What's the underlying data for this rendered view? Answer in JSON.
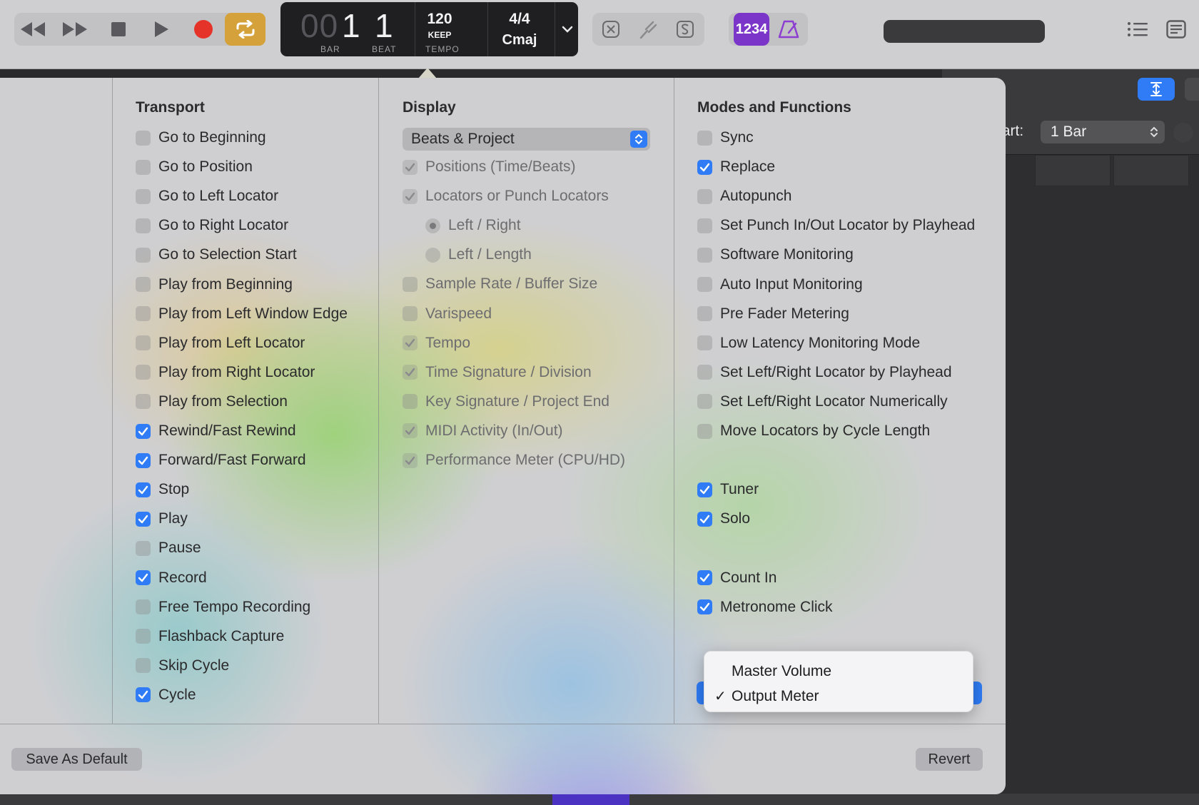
{
  "lcd": {
    "bar_prefix": "00",
    "bar": "1",
    "beat": "1",
    "bar_label": "BAR",
    "beat_label": "BEAT",
    "tempo": "120",
    "tempo_mode": "KEEP",
    "tempo_label": "TEMPO",
    "time_signature": "4/4",
    "key": "Cmaj"
  },
  "toolbar": {
    "count_in_label": "1234"
  },
  "colors": {
    "accent": "#2f7cf6",
    "record": "#e5332a",
    "cycle": "#d4a13a",
    "count_in": "#7b35c9"
  },
  "popover": {
    "transport": {
      "title": "Transport",
      "items": [
        {
          "label": "Go to Beginning",
          "checked": false
        },
        {
          "label": "Go to Position",
          "checked": false
        },
        {
          "label": "Go to Left Locator",
          "checked": false
        },
        {
          "label": "Go to Right Locator",
          "checked": false
        },
        {
          "label": "Go to Selection Start",
          "checked": false
        },
        {
          "label": "Play from Beginning",
          "checked": false
        },
        {
          "label": "Play from Left Window Edge",
          "checked": false
        },
        {
          "label": "Play from Left Locator",
          "checked": false
        },
        {
          "label": "Play from Right Locator",
          "checked": false
        },
        {
          "label": "Play from Selection",
          "checked": false
        },
        {
          "label": "Rewind/Fast Rewind",
          "checked": true
        },
        {
          "label": "Forward/Fast Forward",
          "checked": true
        },
        {
          "label": "Stop",
          "checked": true
        },
        {
          "label": "Play",
          "checked": true
        },
        {
          "label": "Pause",
          "checked": false
        },
        {
          "label": "Record",
          "checked": true
        },
        {
          "label": "Free Tempo Recording",
          "checked": false
        },
        {
          "label": "Flashback Capture",
          "checked": false
        },
        {
          "label": "Skip Cycle",
          "checked": false
        },
        {
          "label": "Cycle",
          "checked": true
        }
      ]
    },
    "display": {
      "title": "Display",
      "mode_select": "Beats & Project",
      "items": [
        {
          "label": "Positions (Time/Beats)",
          "checked": true
        },
        {
          "label": "Locators or Punch Locators",
          "checked": true
        },
        {
          "label": "Left / Right",
          "radio": true,
          "selected": true
        },
        {
          "label": "Left / Length",
          "radio": true,
          "selected": false
        },
        {
          "label": "Sample Rate / Buffer Size",
          "checked": false
        },
        {
          "label": "Varispeed",
          "checked": false
        },
        {
          "label": "Tempo",
          "checked": true
        },
        {
          "label": "Time Signature / Division",
          "checked": true
        },
        {
          "label": "Key Signature / Project End",
          "checked": false
        },
        {
          "label": "MIDI Activity (In/Out)",
          "checked": true
        },
        {
          "label": "Performance Meter (CPU/HD)",
          "checked": true
        }
      ]
    },
    "modes": {
      "title": "Modes and Functions",
      "items": [
        {
          "label": "Sync",
          "checked": false
        },
        {
          "label": "Replace",
          "checked": true
        },
        {
          "label": "Autopunch",
          "checked": false
        },
        {
          "label": "Set Punch In/Out Locator by Playhead",
          "checked": false
        },
        {
          "label": "Software Monitoring",
          "checked": false
        },
        {
          "label": "Auto Input Monitoring",
          "checked": false
        },
        {
          "label": "Pre Fader Metering",
          "checked": false
        },
        {
          "label": "Low Latency Monitoring Mode",
          "checked": false
        },
        {
          "label": "Set Left/Right Locator by Playhead",
          "checked": false
        },
        {
          "label": "Set Left/Right Locator Numerically",
          "checked": false
        },
        {
          "label": "Move Locators by Cycle Length",
          "checked": false
        },
        {
          "label": "Tuner",
          "checked": true
        },
        {
          "label": "Solo",
          "checked": true
        },
        {
          "label": "Count In",
          "checked": true
        },
        {
          "label": "Metronome Click",
          "checked": true
        }
      ]
    },
    "save_default_label": "Save As Default",
    "revert_label": "Revert"
  },
  "dropdown_menu": {
    "items": [
      {
        "label": "Master Volume",
        "checked": false
      },
      {
        "label": "Output Meter",
        "checked": true
      }
    ],
    "check_glyph": "✓"
  },
  "right_panel": {
    "start_label": "tart:",
    "start_value": "1 Bar"
  }
}
